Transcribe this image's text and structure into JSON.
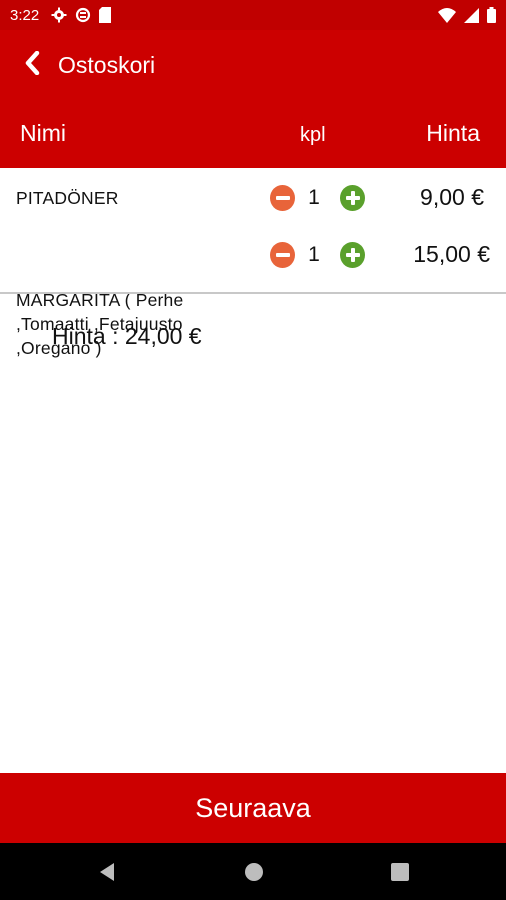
{
  "status_bar": {
    "time": "3:22",
    "left_icons": [
      "gear-icon",
      "sync-icon",
      "sd-card-icon"
    ],
    "right_icons": [
      "wifi-icon",
      "signal-icon",
      "battery-icon"
    ]
  },
  "app_bar": {
    "title": "Ostoskori",
    "back_icon": "chevron-left-icon"
  },
  "columns": {
    "name": "Nimi",
    "qty": "kpl",
    "price": "Hinta"
  },
  "items": [
    {
      "name": "PITADÖNER",
      "qty": "1",
      "price": "9,00 €"
    },
    {
      "name": "MARGARITA ( Perhe ,Tomaatti ,Fetajuusto ,Oregano )",
      "qty": "1",
      "price": "15,00 €"
    }
  ],
  "total": {
    "text": "Hinta : 24,00 €"
  },
  "next_button": {
    "label": "Seuraava"
  },
  "nav_bar": {
    "icons": [
      "back-triangle-icon",
      "home-circle-icon",
      "recents-square-icon"
    ]
  },
  "colors": {
    "primary_red": "#cc0000",
    "minus_orange": "#e8643a",
    "plus_green": "#5aa02c"
  }
}
